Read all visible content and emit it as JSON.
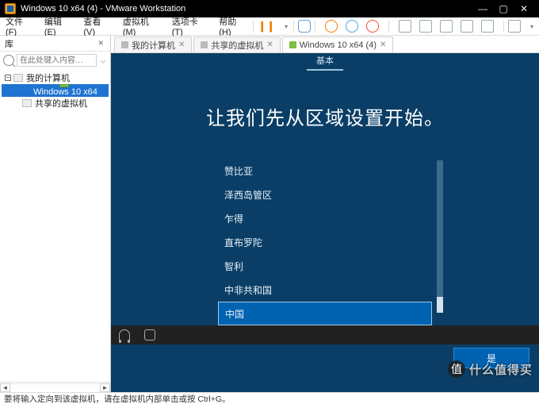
{
  "titlebar": {
    "title": "Windows 10 x64 (4) - VMware Workstation"
  },
  "menu": {
    "file": "文件(F)",
    "edit": "编辑(E)",
    "view": "查看(V)",
    "vm": "虚拟机(M)",
    "tabs": "选项卡(T)",
    "help": "帮助(H)"
  },
  "library": {
    "title": "库",
    "search_placeholder": "在此处键入内容…",
    "root": "我的计算机",
    "selected_vm": "Windows 10 x64",
    "shared": "共享的虚拟机"
  },
  "tabs": {
    "home": "我的计算机",
    "shared": "共享的虚拟机",
    "active": "Windows 10 x64 (4)"
  },
  "oobe": {
    "subtab": "基本",
    "heading": "让我们先从区域设置开始。",
    "regions": [
      "赞比亚",
      "泽西岛管区",
      "乍得",
      "直布罗陀",
      "智利",
      "中非共和国",
      "中国"
    ],
    "selected_region_index": 6,
    "yes": "是"
  },
  "status": {
    "text": "要将输入定向到该虚拟机，请在虚拟机内部单击或按 Ctrl+G。"
  },
  "watermark": {
    "icon": "值",
    "text": "什么值得买"
  }
}
